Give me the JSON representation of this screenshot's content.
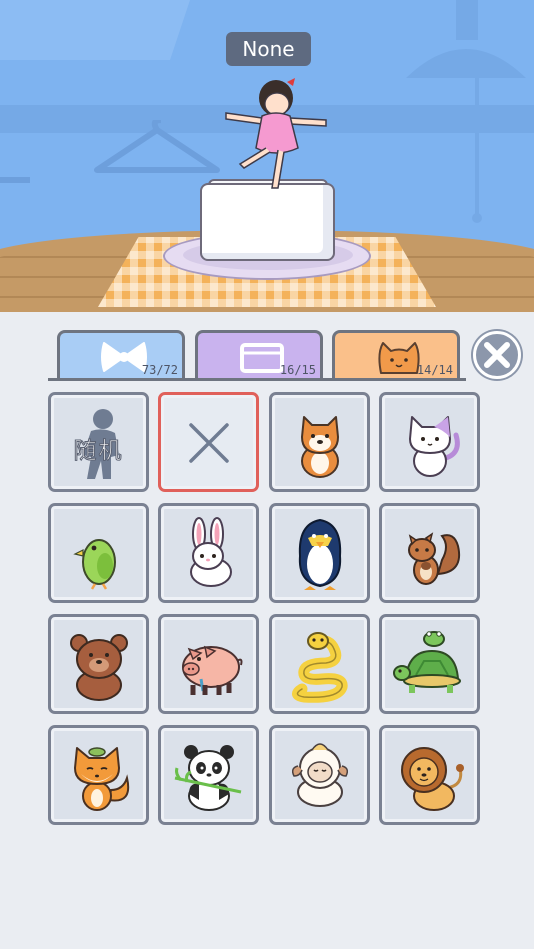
{
  "character": {
    "name": "None"
  },
  "tabs": [
    {
      "id": "bows",
      "icon": "bow-icon",
      "count": "73/72",
      "color": "#a9cdf5"
    },
    {
      "id": "furniture",
      "icon": "box-icon",
      "count": "16/15",
      "color": "#c9b3ee"
    },
    {
      "id": "pets",
      "icon": "cat-face-icon",
      "count": "14/14",
      "color": "#fac08a",
      "active": true
    }
  ],
  "grid": {
    "random_label": "随机",
    "items": [
      {
        "name": "random",
        "label": "随机"
      },
      {
        "name": "none",
        "selected": true
      },
      {
        "name": "shiba-dog"
      },
      {
        "name": "white-cat"
      },
      {
        "name": "green-parrot"
      },
      {
        "name": "white-rabbit"
      },
      {
        "name": "penguin"
      },
      {
        "name": "squirrel"
      },
      {
        "name": "brown-bear"
      },
      {
        "name": "pink-pig"
      },
      {
        "name": "yellow-snake"
      },
      {
        "name": "turtle-and-frog"
      },
      {
        "name": "fox"
      },
      {
        "name": "panda"
      },
      {
        "name": "sheep"
      },
      {
        "name": "lion"
      }
    ]
  }
}
